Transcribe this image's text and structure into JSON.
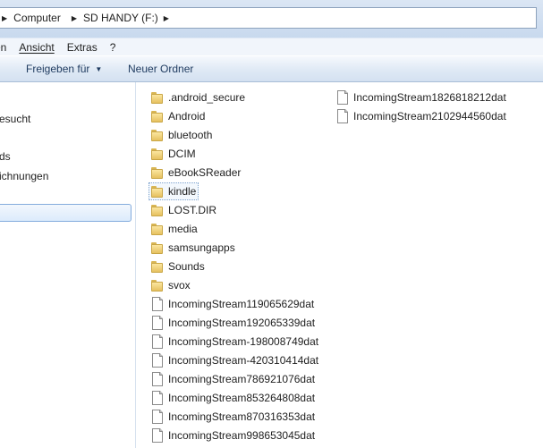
{
  "breadcrumb": {
    "items": [
      "Computer",
      "SD HANDY (F:)"
    ]
  },
  "menu": {
    "items": [
      "en",
      "Ansicht",
      "Extras",
      "?"
    ]
  },
  "commandbar": {
    "share_label": "Freigeben für",
    "new_folder_label": "Neuer Ordner"
  },
  "navpane": {
    "items": [
      "esucht",
      "ds",
      "ichnungen"
    ]
  },
  "files": {
    "column1": [
      {
        "name": ".android_secure",
        "type": "folder"
      },
      {
        "name": "Android",
        "type": "folder"
      },
      {
        "name": "bluetooth",
        "type": "folder"
      },
      {
        "name": "DCIM",
        "type": "folder"
      },
      {
        "name": "eBookSReader",
        "type": "folder"
      },
      {
        "name": "kindle",
        "type": "folder"
      },
      {
        "name": "LOST.DIR",
        "type": "folder"
      },
      {
        "name": "media",
        "type": "folder"
      },
      {
        "name": "samsungapps",
        "type": "folder"
      },
      {
        "name": "Sounds",
        "type": "folder"
      },
      {
        "name": "svox",
        "type": "folder"
      },
      {
        "name": "IncomingStream119065629dat",
        "type": "file"
      },
      {
        "name": "IncomingStream192065339dat",
        "type": "file"
      },
      {
        "name": "IncomingStream-198008749dat",
        "type": "file"
      },
      {
        "name": "IncomingStream-420310414dat",
        "type": "file"
      },
      {
        "name": "IncomingStream786921076dat",
        "type": "file"
      },
      {
        "name": "IncomingStream853264808dat",
        "type": "file"
      },
      {
        "name": "IncomingStream870316353dat",
        "type": "file"
      },
      {
        "name": "IncomingStream998653045dat",
        "type": "file"
      }
    ],
    "column2": [
      {
        "name": "IncomingStream1826818212dat",
        "type": "file"
      },
      {
        "name": "IncomingStream2102944560dat",
        "type": "file"
      }
    ]
  }
}
